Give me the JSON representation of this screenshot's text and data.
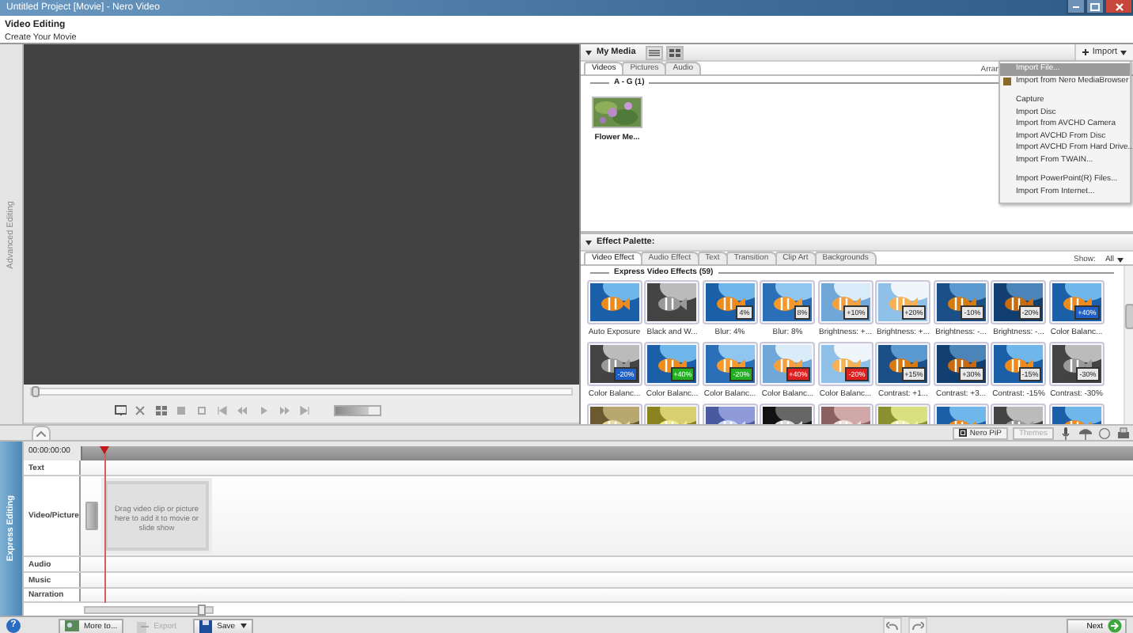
{
  "window": {
    "title": "Untitled Project [Movie] - Nero Video"
  },
  "header": {
    "title": "Video Editing",
    "subtitle": "Create Your Movie"
  },
  "side_tabs": [
    {
      "label": "Advanced Editing",
      "selected": false
    },
    {
      "label": "Express Editing",
      "selected": true
    }
  ],
  "my_media": {
    "title": "My Media",
    "import_button": "Import",
    "arrange_label": "Arran",
    "group": "A - G (1)",
    "tabs": [
      {
        "label": "Videos",
        "selected": true
      },
      {
        "label": "Pictures",
        "selected": false
      },
      {
        "label": "Audio",
        "selected": false
      }
    ],
    "items": [
      {
        "label": "Flower Me..."
      }
    ],
    "import_menu": [
      {
        "kind": "item",
        "label": "Import File...",
        "selected": true
      },
      {
        "kind": "item",
        "label": "Import from Nero MediaBrowser",
        "selected": false,
        "icon": true
      },
      {
        "kind": "separator"
      },
      {
        "kind": "item",
        "label": "Capture",
        "selected": false
      },
      {
        "kind": "item",
        "label": "Import Disc",
        "selected": false
      },
      {
        "kind": "item",
        "label": "Import from AVCHD Camera",
        "selected": false
      },
      {
        "kind": "item",
        "label": "Import AVCHD From Disc",
        "selected": false
      },
      {
        "kind": "item",
        "label": "Import AVCHD From Hard Drive...",
        "selected": false
      },
      {
        "kind": "item",
        "label": "Import From TWAIN...",
        "selected": false
      },
      {
        "kind": "separator"
      },
      {
        "kind": "item",
        "label": "Import PowerPoint(R) Files...",
        "selected": false
      },
      {
        "kind": "item",
        "label": "Import From Internet...",
        "selected": false
      }
    ]
  },
  "effect_palette": {
    "title": "Effect Palette:",
    "show_label": "Show:",
    "show_value": "All",
    "group": "Express Video Effects (59)",
    "tabs": [
      {
        "label": "Video Effect",
        "selected": true
      },
      {
        "label": "Audio Effect",
        "selected": false
      },
      {
        "label": "Text",
        "selected": false
      },
      {
        "label": "Transition",
        "selected": false
      },
      {
        "label": "Clip Art",
        "selected": false
      },
      {
        "label": "Backgrounds",
        "selected": false
      }
    ],
    "effects": [
      {
        "kind": "effect",
        "label": "Auto Exposure"
      },
      {
        "kind": "effect",
        "label": "Black and W..."
      },
      {
        "kind": "effect",
        "label": "Blur: 4%",
        "badge": "4%",
        "color": "#e8e8e8"
      },
      {
        "kind": "effect",
        "label": "Blur: 8%",
        "badge": "8%",
        "color": "#e8e8e8"
      },
      {
        "kind": "effect",
        "label": "Brightness: +...",
        "badge": "+10%",
        "color": "#e8e8e8"
      },
      {
        "kind": "effect",
        "label": "Brightness: +...",
        "badge": "+20%",
        "color": "#e8e8e8"
      },
      {
        "kind": "effect",
        "label": "Brightness: -...",
        "badge": "-10%",
        "color": "#e8e8e8"
      },
      {
        "kind": "effect",
        "label": "Brightness: -...",
        "badge": "-20%",
        "color": "#e8e8e8"
      },
      {
        "kind": "effect",
        "label": "Color Balanc...",
        "badge": "+40%",
        "color": "#1e5fc8"
      },
      {
        "kind": "effect",
        "label": "Color Balanc...",
        "badge": "-20%",
        "color": "#1e5fc8"
      },
      {
        "kind": "effect",
        "label": "Color Balanc...",
        "badge": "+40%",
        "color": "#22b022"
      },
      {
        "kind": "effect",
        "label": "Color Balanc...",
        "badge": "-20%",
        "color": "#22b022"
      },
      {
        "kind": "effect",
        "label": "Color Balanc...",
        "badge": "+40%",
        "color": "#e02020"
      },
      {
        "kind": "effect",
        "label": "Color Balanc...",
        "badge": "-20%",
        "color": "#e02020"
      },
      {
        "kind": "effect",
        "label": "Contrast: +1...",
        "badge": "+15%",
        "color": "#e8e8e8"
      },
      {
        "kind": "effect",
        "label": "Contrast: +3...",
        "badge": "+30%",
        "color": "#e8e8e8"
      },
      {
        "kind": "effect",
        "label": "Contrast: -15%",
        "badge": "-15%",
        "color": "#e8e8e8"
      },
      {
        "kind": "effect",
        "label": "Contrast: -30%",
        "badge": "-30%",
        "color": "#e8e8e8"
      },
      {
        "kind": "picture"
      },
      {
        "kind": "picture"
      },
      {
        "kind": "picture"
      },
      {
        "kind": "picture"
      },
      {
        "kind": "picture"
      },
      {
        "kind": "picture"
      },
      {
        "kind": "picture"
      },
      {
        "kind": "picture"
      },
      {
        "kind": "picture"
      }
    ]
  },
  "preview": {
    "seek": {
      "level": 0
    },
    "volume": {
      "level": 0.75
    }
  },
  "toolbar": {
    "pip_button": "Nero PiP",
    "themes_button": {
      "label": "Themes",
      "disabled": true
    }
  },
  "timeline": {
    "timecode": "00:00:00:00",
    "zoom": {
      "level": 0.95
    },
    "drop_hint": "Drag video clip or picture here to add it to movie or slide show",
    "tracks": [
      {
        "kind": "text",
        "label": "Text"
      },
      {
        "kind": "video",
        "label": "Video/Picture"
      },
      {
        "kind": "audio",
        "label": "Audio"
      },
      {
        "kind": "music",
        "label": "Music"
      },
      {
        "kind": "narration",
        "label": "Narration"
      }
    ]
  },
  "bottom_bar": {
    "help_button": "?",
    "move_button": "More to...",
    "export_button": {
      "label": "Export",
      "disabled": true
    },
    "save_button": "Save",
    "next_button": "Next"
  }
}
